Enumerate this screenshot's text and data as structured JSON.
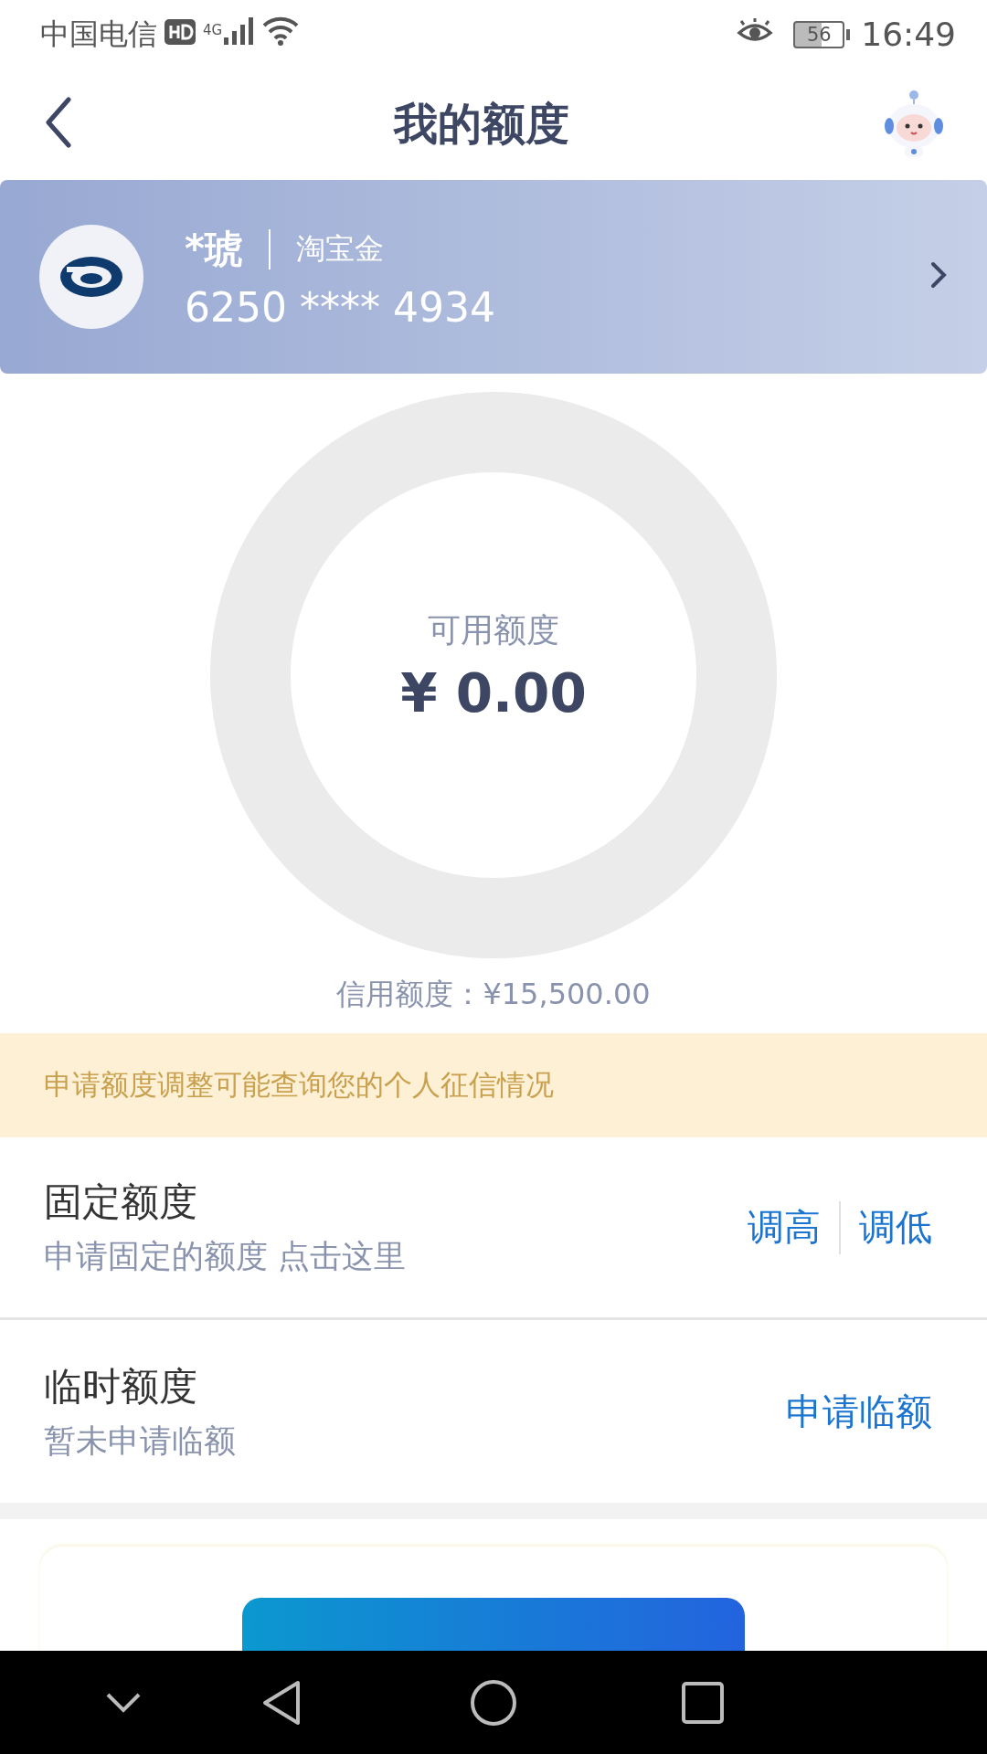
{
  "status_bar": {
    "carrier": "中国电信",
    "network": "4G",
    "battery": "56",
    "time": "16:49"
  },
  "header": {
    "title": "我的额度"
  },
  "card": {
    "name": "*琥",
    "type": "淘宝金",
    "number": "6250 **** 4934"
  },
  "available": {
    "label": "可用额度",
    "amount": "¥ 0.00"
  },
  "credit_limit": "信用额度：¥15,500.00",
  "notice": "申请额度调整可能查询您的个人征信情况",
  "rows": [
    {
      "title": "固定额度",
      "subtitle": "申请固定的额度 点击这里",
      "actions": [
        "调高",
        "调低"
      ]
    },
    {
      "title": "临时额度",
      "subtitle": "暂未申请临额",
      "actions": [
        "申请临额"
      ]
    }
  ]
}
